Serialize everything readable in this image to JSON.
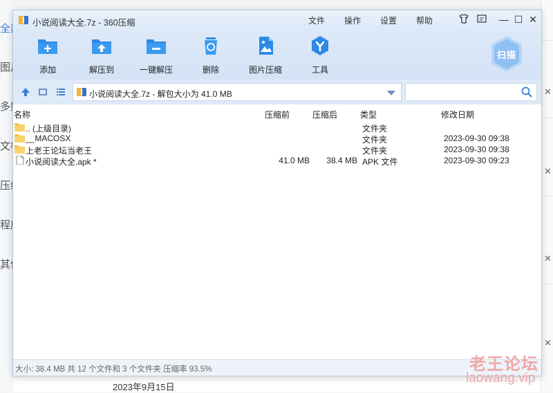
{
  "background": {
    "sidebar_items": [
      "全部",
      "图片",
      "多媒",
      "文档",
      "压缩",
      "程序",
      "其他"
    ],
    "date_text": "2023年9月15日"
  },
  "window": {
    "title": "小说阅读大全.7z - 360压缩",
    "menu": [
      "文件",
      "操作",
      "设置",
      "帮助"
    ],
    "toolbar": [
      {
        "label": "添加",
        "icon": "add-icon"
      },
      {
        "label": "解压到",
        "icon": "extract-to-icon"
      },
      {
        "label": "一键解压",
        "icon": "one-click-extract-icon"
      },
      {
        "label": "删除",
        "icon": "delete-icon"
      },
      {
        "label": "图片压缩",
        "icon": "image-compress-icon"
      },
      {
        "label": "工具",
        "icon": "tools-icon"
      }
    ],
    "scan_label": "扫描",
    "path": "小说阅读大全.7z - 解包大小为 41.0 MB",
    "search_placeholder": "",
    "columns": {
      "name": "名称",
      "size": "压缩前",
      "csize": "压缩后",
      "type": "类型",
      "date": "修改日期"
    },
    "rows": [
      {
        "name": ".. (上级目录)",
        "size": "",
        "csize": "",
        "type": "文件夹",
        "date": "",
        "icon": "folder-icon"
      },
      {
        "name": "__MACOSX",
        "size": "",
        "csize": "",
        "type": "文件夹",
        "date": "2023-09-30 09:38",
        "icon": "folder-icon"
      },
      {
        "name": "上老王论坛当老王",
        "size": "",
        "csize": "",
        "type": "文件夹",
        "date": "2023-09-30 09:38",
        "icon": "folder-icon"
      },
      {
        "name": "小说阅读大全.apk *",
        "size": "41.0 MB",
        "csize": "38.4 MB",
        "type": "APK 文件",
        "date": "2023-09-30 09:23",
        "icon": "file-icon"
      }
    ],
    "status": "大小: 38.4 MB 共 12 个文件和 3 个文件夹 压缩率 93.5%"
  },
  "watermark": {
    "line1": "老王论坛",
    "line2": "laowang.vip"
  },
  "colors": {
    "accent": "#2d8ae6",
    "toolbar_bg": "#d7e6f7",
    "folder": "#f3c24a"
  }
}
